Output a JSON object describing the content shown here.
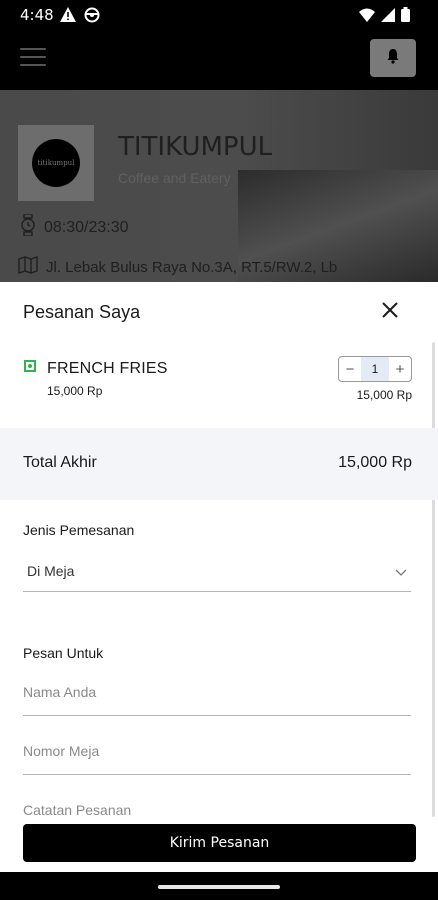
{
  "status_bar": {
    "time": "4:48",
    "icons": [
      "warning-icon",
      "steering-wheel-icon",
      "wifi-icon",
      "signal-icon",
      "battery-icon"
    ]
  },
  "app_bar": {
    "icons": [
      "menu-icon",
      "bell-icon"
    ]
  },
  "store": {
    "logo_text": "titikumpul",
    "name": "TITIKUMPUL",
    "tagline": "Coffee and Eatery",
    "hours": "08:30/23:30",
    "address": "Jl. Lebak Bulus Raya No.3A, RT.5/RW.2, Lb"
  },
  "sheet": {
    "title": "Pesanan Saya",
    "items": [
      {
        "name": "FRENCH FRIES",
        "price": "15,000 Rp",
        "quantity": "1",
        "subtotal": "15,000 Rp",
        "decrement": "−",
        "increment": "+"
      }
    ],
    "total_label": "Total Akhir",
    "total_value": "15,000 Rp",
    "order_type_label": "Jenis Pemesanan",
    "order_type_value": "Di Meja",
    "for_label": "Pesan Untuk",
    "name_placeholder": "Nama Anda",
    "table_placeholder": "Nomor Meja",
    "notes_placeholder": "Catatan Pesanan",
    "submit_label": "Kirim Pesanan"
  },
  "colors": {
    "accent": "#000000",
    "veg": "#2fb34a",
    "stepper_value_bg": "#e4ebf7",
    "total_band": "#f3f5f8"
  }
}
